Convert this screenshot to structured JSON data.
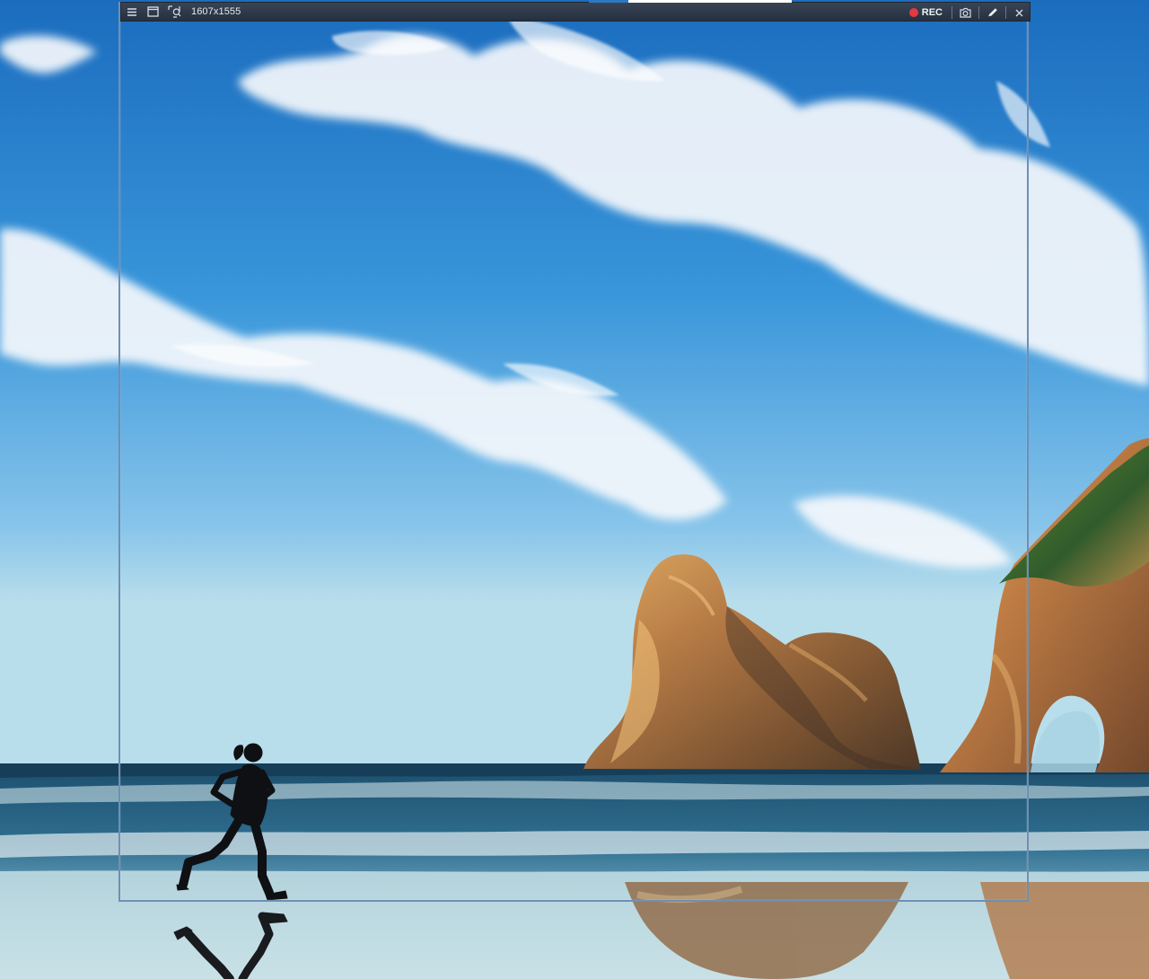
{
  "wallpaper": {
    "scene_name": "beach-runner-wallpaper",
    "colors": {
      "sky_deep": "#1f71c2",
      "sky_light": "#7fbfe6",
      "cloud": "#f4f7fb",
      "rock": "#c58a4f",
      "ocean": "#255a76",
      "sand_reflection": "#b2d0d8",
      "runner": "#101114"
    }
  },
  "recorder": {
    "dimensions": "1607x1555",
    "rec_label": "REC",
    "icons": {
      "menu": "menu-icon",
      "window": "window-icon",
      "region": "region-capture-icon",
      "record": "record-dot-icon",
      "camera": "camera-icon",
      "pen": "pen-icon",
      "close": "close-icon"
    },
    "colors": {
      "toolbar": "#253140",
      "frame": "#6f8fb5",
      "record": "#e5383f"
    }
  }
}
